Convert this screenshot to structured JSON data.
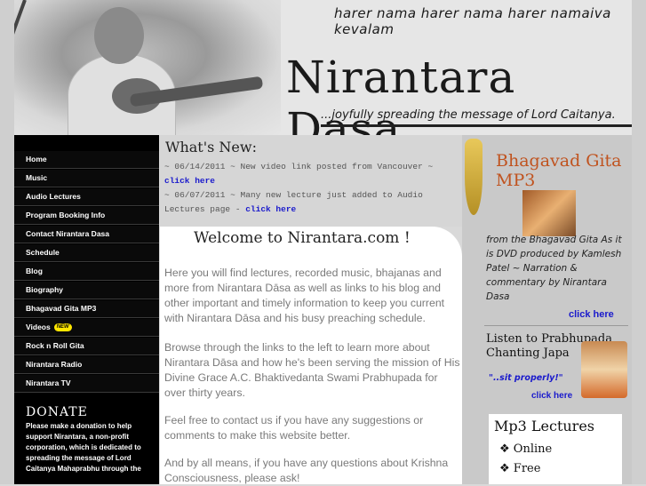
{
  "header": {
    "mantra": "harer nama harer nama harer namaiva kevalam",
    "site_title": "Nirantara Dasa",
    "tagline": "...joyfully spreading the message of Lord Caitanya."
  },
  "nav": {
    "items": [
      {
        "label": "Home"
      },
      {
        "label": "Music"
      },
      {
        "label": "Audio Lectures"
      },
      {
        "label": "Program Booking Info"
      },
      {
        "label": "Contact Nirantara Dasa"
      },
      {
        "label": "Schedule"
      },
      {
        "label": "Blog"
      },
      {
        "label": "Biography"
      },
      {
        "label": "Bhagavad Gita MP3"
      },
      {
        "label": "Videos",
        "badge": "NEW"
      },
      {
        "label": "Rock n Roll Gita"
      },
      {
        "label": "Nirantara Radio"
      },
      {
        "label": "Nirantara TV"
      }
    ],
    "donate_title": "DONATE",
    "donate_text": "Please make a donation to help support Nirantara, a non-profit corporation, which is dedicated to spreading the message of Lord Caitanya Mahaprabhu through the"
  },
  "whats_new": {
    "title": "What's New:",
    "entries": [
      {
        "date": "~ 06/14/2011 ~",
        "text": "New video link posted from Vancouver ~",
        "link": "click here"
      },
      {
        "date": "~ 06/07/2011 ~",
        "text": "Many new lecture just added to Audio Lectures page -",
        "link": "click here"
      }
    ]
  },
  "content": {
    "welcome": "Welcome to Nirantara.com !",
    "paragraphs": [
      "Here you will find lectures, recorded music, bhajanas and more from Nirantara Dāsa as well as links to his blog and other important and timely information to keep you current with Nirantara Dāsa and his busy preaching schedule.",
      "Browse through the links to the left to learn more about Nirantara Dāsa and how he's been serving the mission of His Divine Grace A.C. Bhaktivedanta Swami Prabhupada for over thirty years.",
      "Feel free to contact us if you have any suggestions or comments to make this website better.",
      "And by all means, if you have any questions about Krishna Consciousness, please ask!"
    ]
  },
  "right": {
    "bg_title": "Bhagavad Gita MP3",
    "bg_desc": "from the Bhagavad Gita As it is DVD produced by Kamlesh Patel ~ Narration & commentary by Nirantara Dasa",
    "bg_link": "click here",
    "japa_title": "Listen to Prabhupada Chanting Japa",
    "japa_quote": "\"..sit properly!\"",
    "japa_link": "click here",
    "mp3_title": "Mp3 Lectures",
    "mp3_items": [
      "Online",
      "Free"
    ]
  },
  "colors": {
    "nav_bg": "#000000",
    "link": "#1a1acc",
    "accent_orange": "#c0531f",
    "body_text": "#7a7a7a"
  }
}
